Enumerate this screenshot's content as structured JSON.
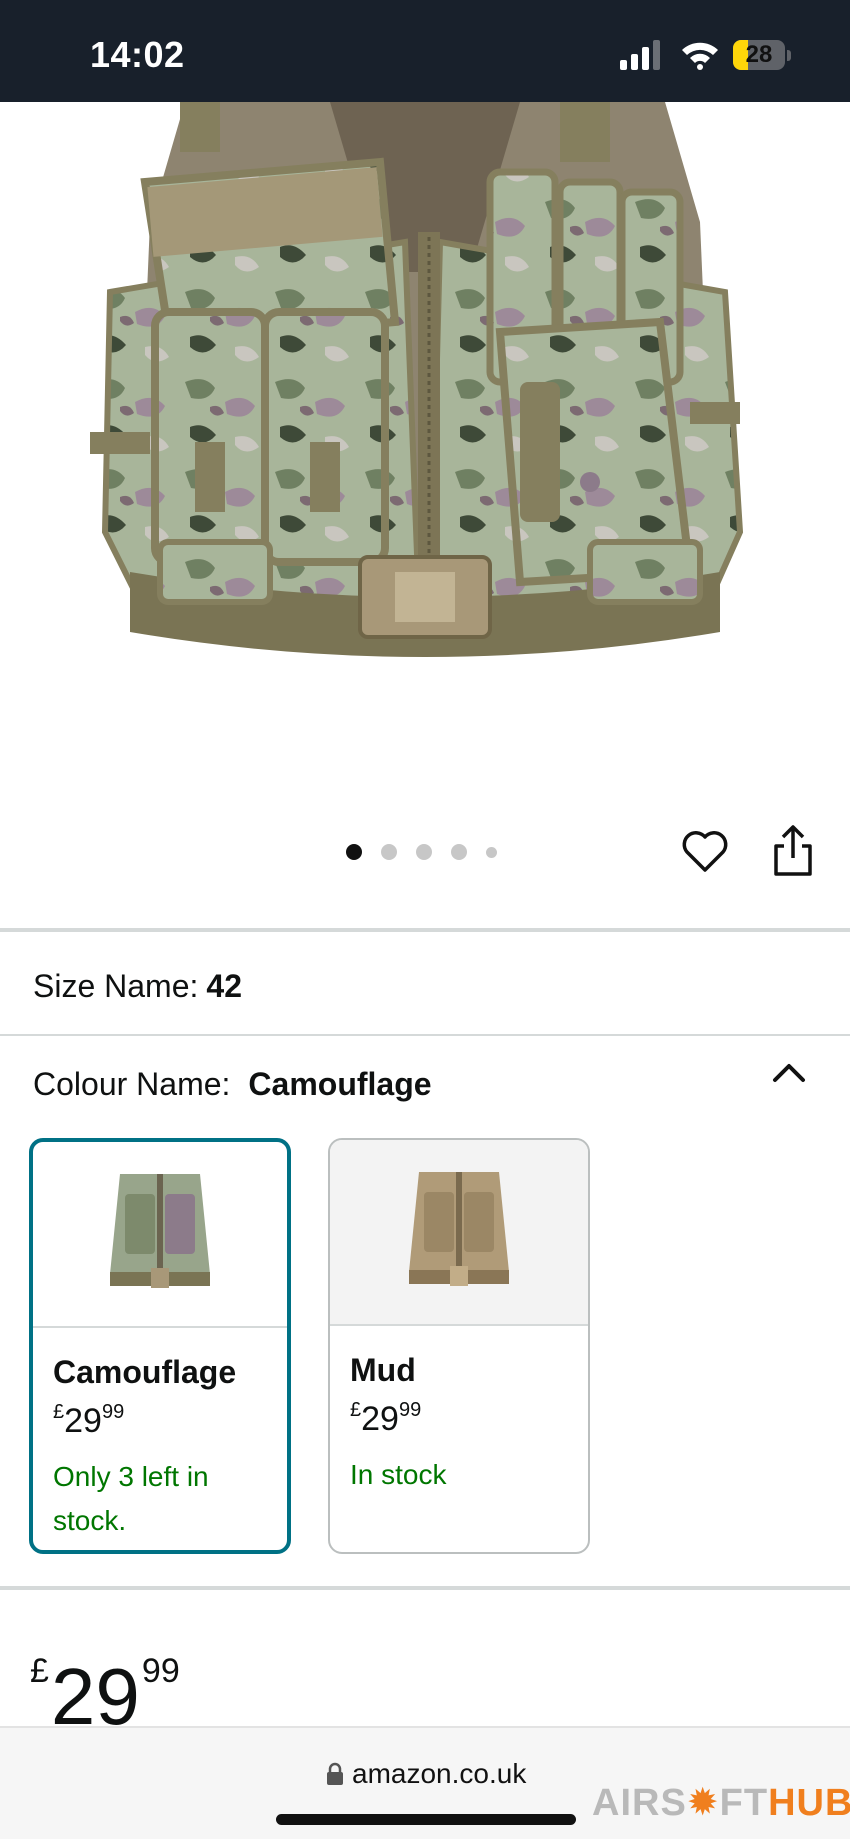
{
  "status_bar": {
    "time": "14:02",
    "battery_level": "28",
    "battery_fraction": 0.28
  },
  "gallery": {
    "total_images": 5,
    "active_index": 0
  },
  "size": {
    "label": "Size Name:",
    "value": "42"
  },
  "colour": {
    "label": "Colour Name:",
    "value": "Camouflage"
  },
  "options": [
    {
      "name": "Camouflage",
      "currency": "£",
      "price_whole": "29",
      "price_fraction": "99",
      "stock": "Only 3 left in stock.",
      "selected": true
    },
    {
      "name": "Mud",
      "currency": "£",
      "price_whole": "29",
      "price_fraction": "99",
      "stock": "In stock",
      "selected": false
    }
  ],
  "price": {
    "currency": "£",
    "whole": "29",
    "fraction": "99"
  },
  "browser": {
    "url": "amazon.co.uk"
  },
  "watermark": {
    "part1": "AIRS",
    "part2": "FT",
    "part3": "HUB"
  },
  "colors": {
    "accent": "#007185",
    "in_stock": "#007600",
    "status_bar": "#18202b",
    "battery": "#ffd60a"
  }
}
